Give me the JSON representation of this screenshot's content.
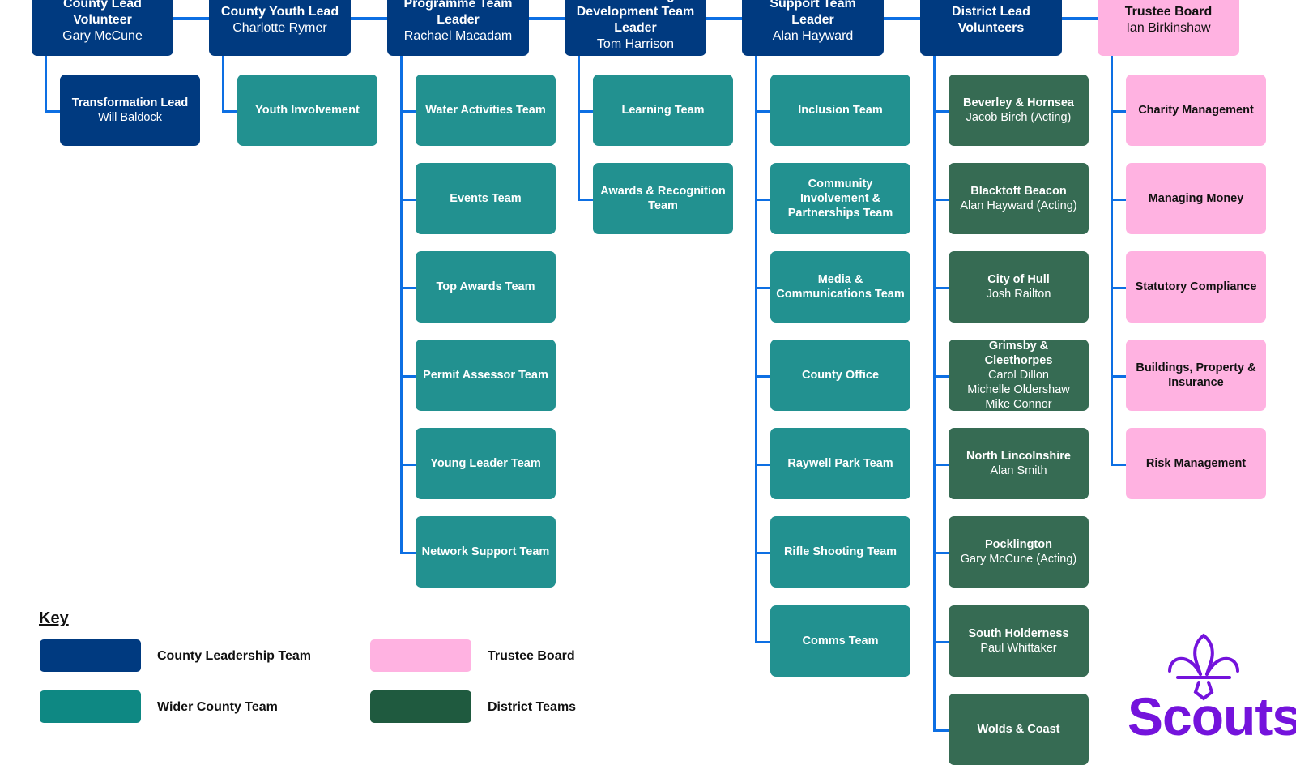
{
  "colors": {
    "county_leadership": "#003a80",
    "wider_county": "#229190",
    "district": "#366b53",
    "trustee": "#ffb2e1",
    "connector": "#0d6fe3",
    "scouts_purple": "#7413dc"
  },
  "columns": [
    {
      "header": {
        "title_lines": [
          "County Lead",
          "Volunteer"
        ],
        "name": "Gary McCune",
        "style": "navy"
      },
      "children": [
        {
          "lines": [
            "Transformation Lead"
          ],
          "names": [
            "Will Baldock"
          ],
          "style": "navy"
        }
      ]
    },
    {
      "header": {
        "title_lines": [
          "County Youth Lead"
        ],
        "name": "Charlotte Rymer",
        "style": "navy"
      },
      "children": [
        {
          "lines": [
            "Youth Involvement"
          ],
          "names": [],
          "style": "teal"
        }
      ]
    },
    {
      "header": {
        "title_lines": [
          "Programme Team",
          "Leader"
        ],
        "name": "Rachael Macadam",
        "style": "navy"
      },
      "children": [
        {
          "lines": [
            "Water Activities Team"
          ],
          "names": [],
          "style": "teal"
        },
        {
          "lines": [
            "Events Team"
          ],
          "names": [],
          "style": "teal"
        },
        {
          "lines": [
            "Top Awards Team"
          ],
          "names": [],
          "style": "teal"
        },
        {
          "lines": [
            "Permit Assessor Team"
          ],
          "names": [],
          "style": "teal"
        },
        {
          "lines": [
            "Young Leader Team"
          ],
          "names": [],
          "style": "teal"
        },
        {
          "lines": [
            "Network Support Team"
          ],
          "names": [],
          "style": "teal"
        }
      ]
    },
    {
      "header": {
        "title_lines": [
          "Volunteering",
          "Development Team",
          "Leader"
        ],
        "name": "Tom Harrison",
        "style": "navy"
      },
      "children": [
        {
          "lines": [
            "Learning Team"
          ],
          "names": [],
          "style": "teal"
        },
        {
          "lines": [
            "Awards & Recognition",
            "Team"
          ],
          "names": [],
          "style": "teal"
        }
      ]
    },
    {
      "header": {
        "title_lines": [
          "Support Team",
          "Leader"
        ],
        "name": "Alan Hayward",
        "style": "navy"
      },
      "children": [
        {
          "lines": [
            "Inclusion Team"
          ],
          "names": [],
          "style": "teal"
        },
        {
          "lines": [
            "Community",
            "Involvement &",
            "Partnerships Team"
          ],
          "names": [],
          "style": "teal"
        },
        {
          "lines": [
            "Media &",
            "Communications Team"
          ],
          "names": [],
          "style": "teal"
        },
        {
          "lines": [
            "County Office"
          ],
          "names": [],
          "style": "teal"
        },
        {
          "lines": [
            "Raywell Park Team"
          ],
          "names": [],
          "style": "teal"
        },
        {
          "lines": [
            "Rifle Shooting Team"
          ],
          "names": [],
          "style": "teal"
        },
        {
          "lines": [
            "Comms Team"
          ],
          "names": [],
          "style": "teal"
        }
      ]
    },
    {
      "header": {
        "title_lines": [
          "District Lead",
          "Volunteers"
        ],
        "name": "",
        "style": "navy"
      },
      "children": [
        {
          "lines": [
            "Beverley & Hornsea"
          ],
          "names": [
            "Jacob Birch (Acting)"
          ],
          "style": "green"
        },
        {
          "lines": [
            "Blacktoft Beacon"
          ],
          "names": [
            "Alan Hayward (Acting)"
          ],
          "style": "green"
        },
        {
          "lines": [
            "City of Hull"
          ],
          "names": [
            "Josh Railton"
          ],
          "style": "green"
        },
        {
          "lines": [
            "Grimsby & Cleethorpes"
          ],
          "names": [
            "Carol Dillon",
            "Michelle Oldershaw",
            "Mike Connor"
          ],
          "style": "green"
        },
        {
          "lines": [
            "North Lincolnshire"
          ],
          "names": [
            "Alan Smith"
          ],
          "style": "green"
        },
        {
          "lines": [
            "Pocklington"
          ],
          "names": [
            "Gary McCune (Acting)"
          ],
          "style": "green"
        },
        {
          "lines": [
            "South Holderness"
          ],
          "names": [
            "Paul Whittaker"
          ],
          "style": "green"
        },
        {
          "lines": [
            "Wolds & Coast"
          ],
          "names": [],
          "style": "green"
        }
      ]
    },
    {
      "header": {
        "title_lines": [
          "Trustee Board"
        ],
        "name": "Ian Birkinshaw",
        "style": "pink"
      },
      "children": [
        {
          "lines": [
            "Charity Management"
          ],
          "names": [],
          "style": "pink"
        },
        {
          "lines": [
            "Managing Money"
          ],
          "names": [],
          "style": "pink"
        },
        {
          "lines": [
            "Statutory Compliance"
          ],
          "names": [],
          "style": "pink"
        },
        {
          "lines": [
            "Buildings, Property &",
            "Insurance"
          ],
          "names": [],
          "style": "pink"
        },
        {
          "lines": [
            "Risk Management"
          ],
          "names": [],
          "style": "pink"
        }
      ]
    }
  ],
  "key": {
    "title": "Key",
    "items": [
      {
        "label": "County Leadership Team",
        "style": "navy"
      },
      {
        "label": "Wider County Team",
        "style": "teal"
      },
      {
        "label": "Trustee Board",
        "style": "pink"
      },
      {
        "label": "District Teams",
        "style": "green"
      }
    ]
  },
  "logo": {
    "text": "Scouts",
    "icon": "fleur-de-lis-icon"
  }
}
